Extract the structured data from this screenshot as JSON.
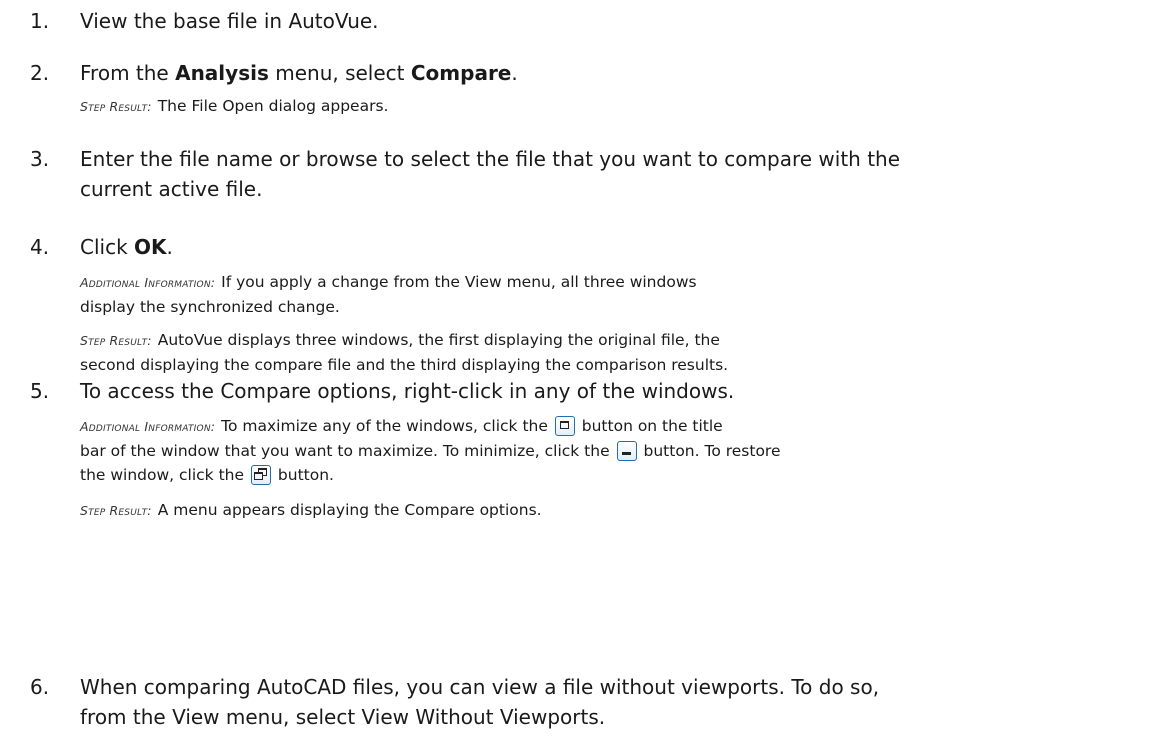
{
  "steps": [
    {
      "number": "1.",
      "text": "View the base file in AutoVue."
    },
    {
      "number": "2.",
      "text_a": "From the ",
      "bold_a": "Analysis",
      "text_b": " menu, select ",
      "bold_b": "Compare",
      "text_c": ".",
      "step_result_label": "Step Result:",
      "step_result": "The File Open dialog appears."
    },
    {
      "number": "3.",
      "text_line1": "Enter the file name or browse to select the file that you want to compare with the",
      "text_line2": "current active file."
    },
    {
      "number": "4.",
      "text_a": "Click ",
      "bold_a": "OK",
      "text_b": ".",
      "additional_info_label": "Additional Information:",
      "additional_info_line1": "If you apply a change from the View menu, all three windows",
      "additional_info_line2": "display the synchronized change.",
      "step_result_label": "Step Result:",
      "step_result_line1": "AutoVue displays three windows, the first displaying the original file, the",
      "step_result_line2": "second displaying the compare file and the third displaying the comparison results."
    },
    {
      "number": "5.",
      "text": "To access the Compare options, right-click in any of the windows.",
      "additional_info_label": "Additional Information:",
      "ai_part1": "To maximize any of the windows, click the",
      "ai_part2": "button on the title",
      "ai_line2_part1": "bar of the window that you want to maximize. To minimize, click the",
      "ai_line2_part2": "button. To restore",
      "ai_line3_part1": "the window, click the",
      "ai_line3_part2": "button.",
      "step_result_label": "Step Result:",
      "step_result": "A menu appears displaying the Compare options."
    },
    {
      "number": "6.",
      "text_line1": "When comparing AutoCAD files, you can view a file without viewports. To do so,",
      "text_line2": "from the View menu, select View Without Viewports."
    }
  ],
  "icons": [
    "maximize-icon",
    "minimize-icon",
    "restore-icon"
  ]
}
